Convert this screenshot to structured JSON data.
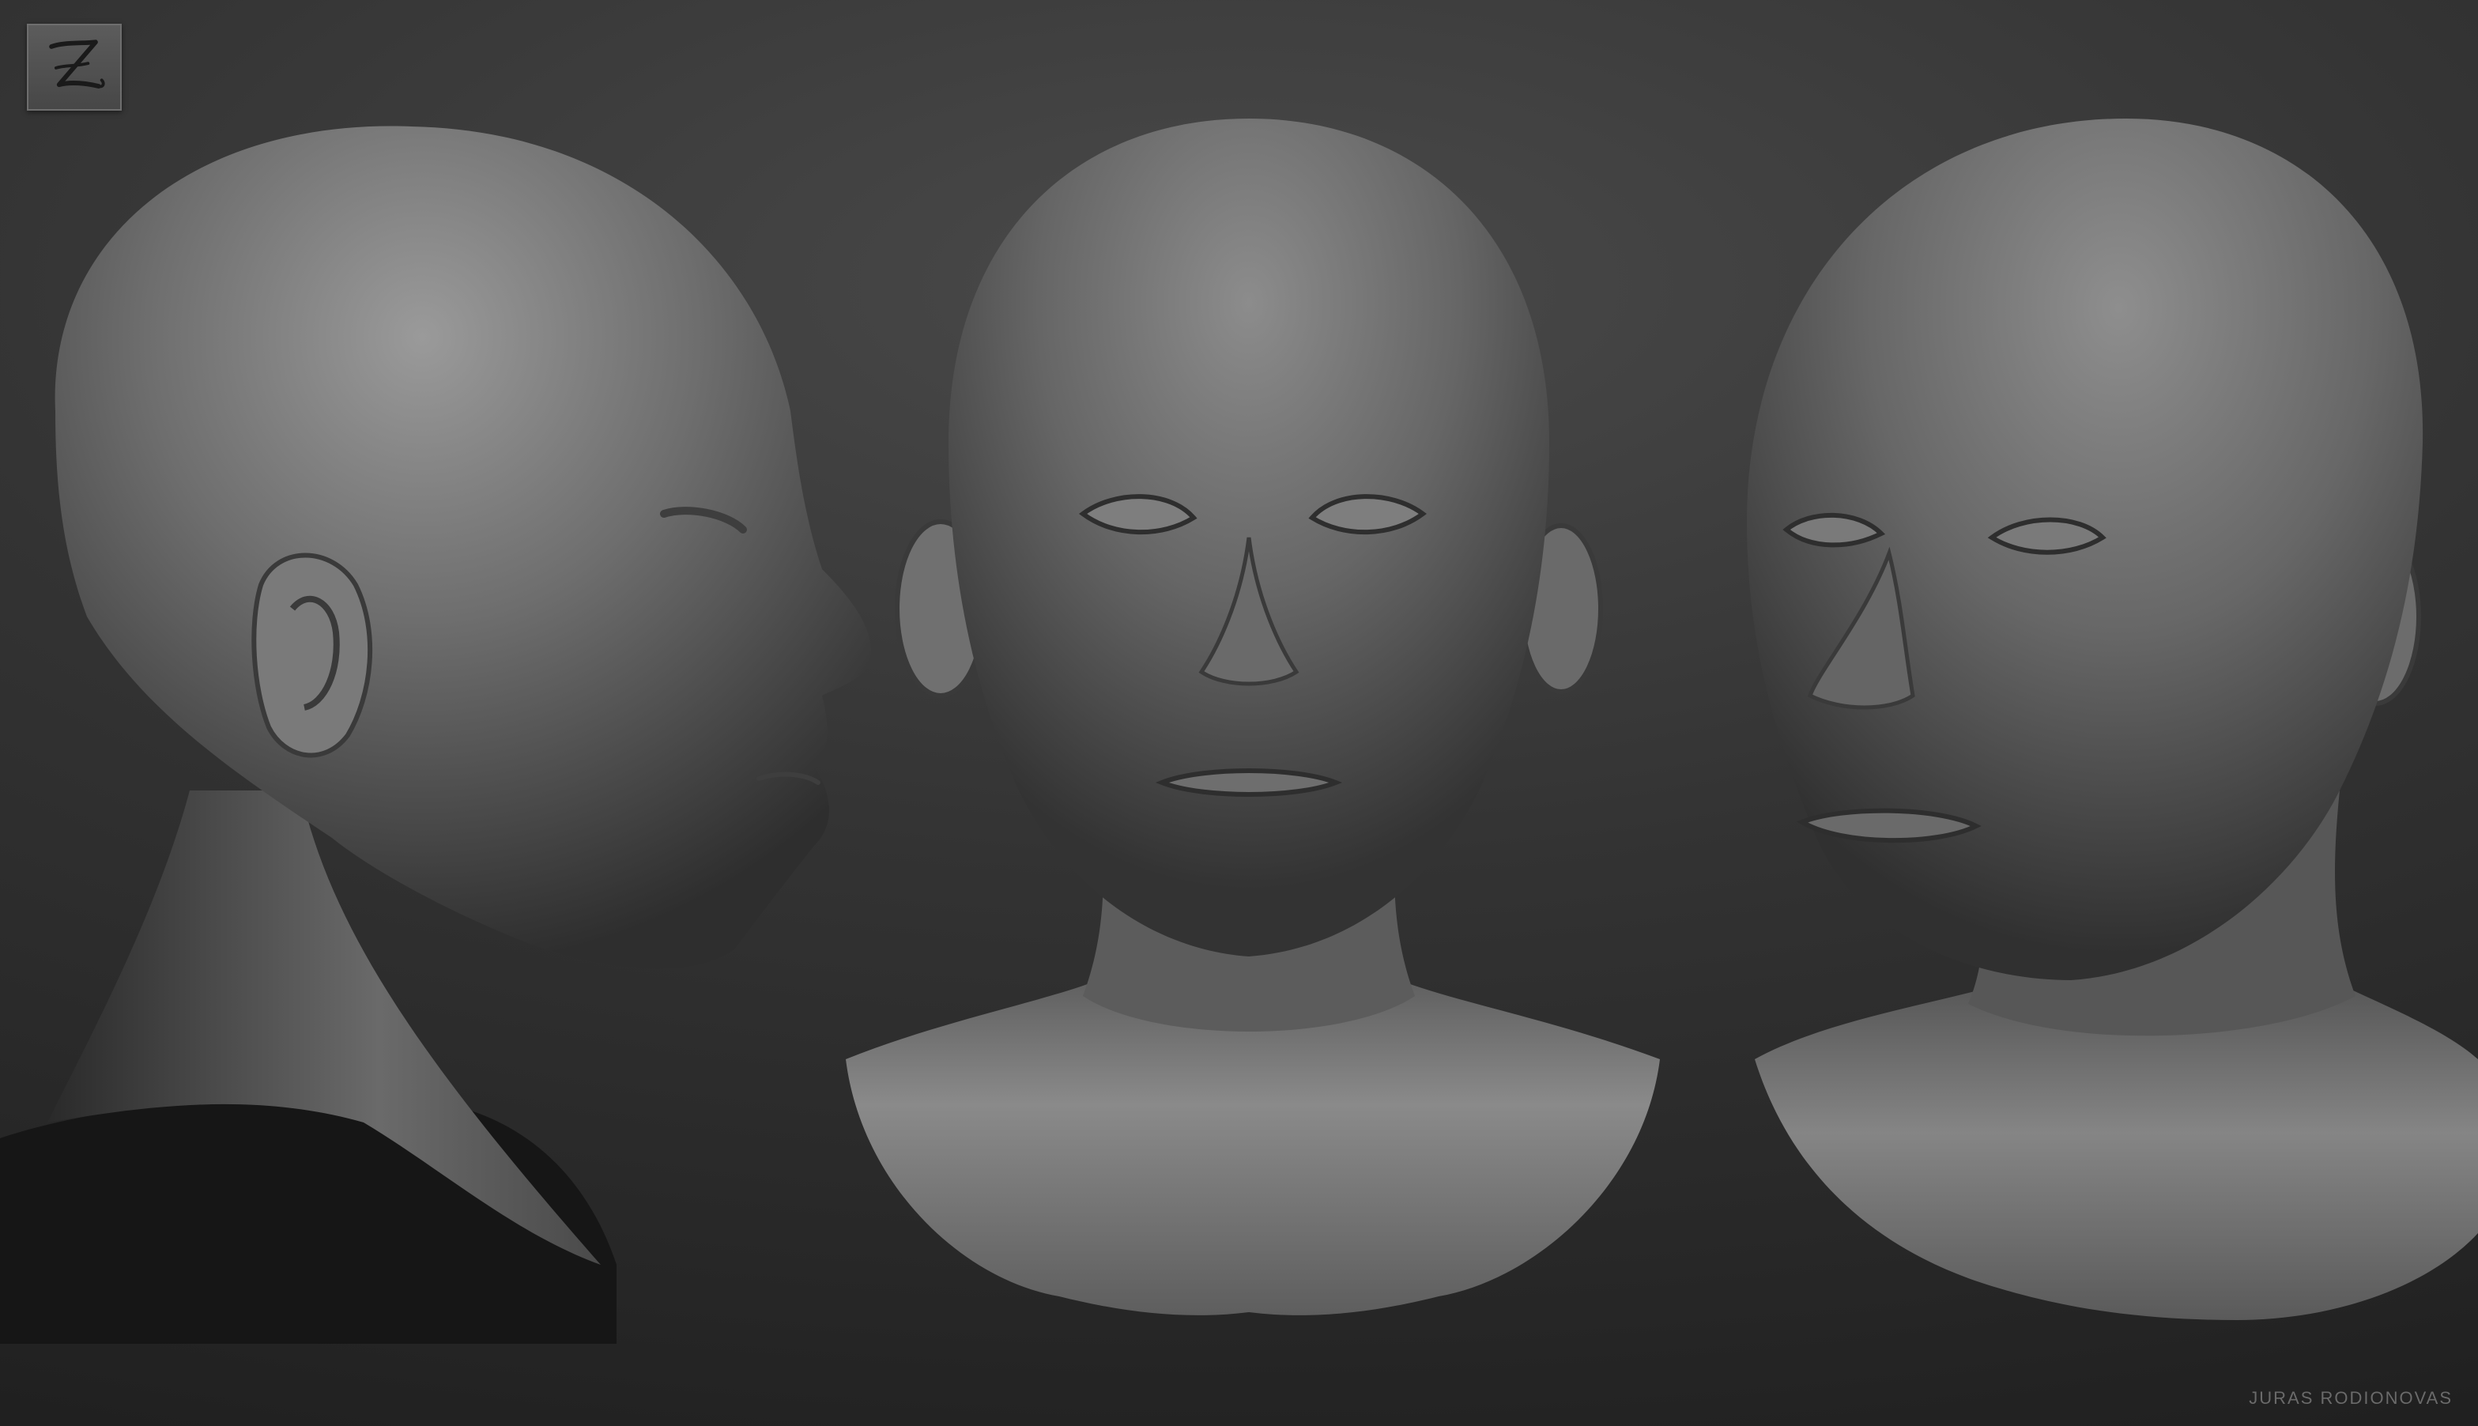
{
  "canvas": {
    "background_top": "#4a4a4a",
    "background_bottom": "#1f1f1f"
  },
  "logo": {
    "icon": "zbrush-z-logo-icon",
    "background": "#525252",
    "stroke": "#1a1a1a"
  },
  "views": [
    {
      "name": "left-profile-view",
      "subject": "sculpted-head-profile"
    },
    {
      "name": "front-view",
      "subject": "sculpted-head-front"
    },
    {
      "name": "three-quarter-view",
      "subject": "sculpted-head-three-quarter"
    }
  ],
  "colors": {
    "sculpt_light": "#9a9a9a",
    "sculpt_mid": "#6e6e6e",
    "sculpt_dark": "#3a3a3a",
    "shadow": "#161616"
  },
  "credit": {
    "text": "JURAS RODIONOVAS"
  }
}
